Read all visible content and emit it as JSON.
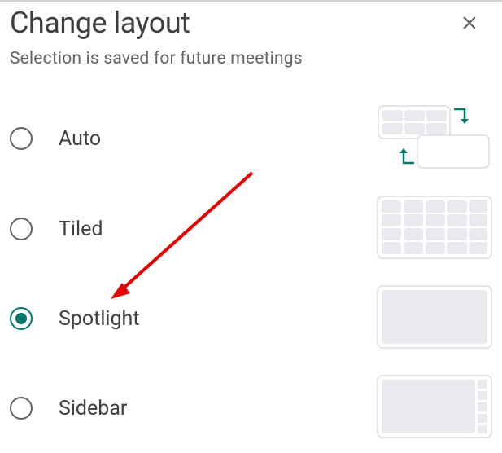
{
  "dialog": {
    "title": "Change layout",
    "subtitle": "Selection is saved for future meetings"
  },
  "options": [
    {
      "id": "auto",
      "label": "Auto",
      "selected": false
    },
    {
      "id": "tiled",
      "label": "Tiled",
      "selected": false
    },
    {
      "id": "spotlight",
      "label": "Spotlight",
      "selected": true
    },
    {
      "id": "sidebar",
      "label": "Sidebar",
      "selected": false
    }
  ],
  "colors": {
    "accent": "#00796b",
    "text_primary": "#3c4043",
    "text_secondary": "#5f6368",
    "preview_fill": "#e8eaed",
    "preview_stroke": "#dadce0",
    "arrow": "#e60000"
  }
}
